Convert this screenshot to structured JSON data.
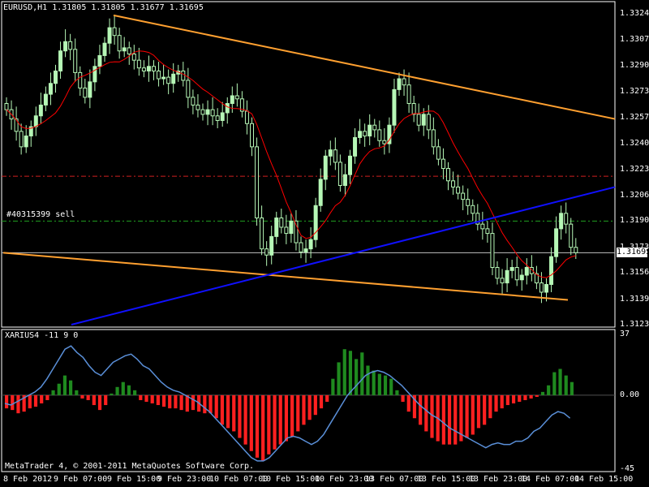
{
  "window": {
    "title": "EURUSD,H1  1.31805 1.31805 1.31677 1.31695",
    "copyright": "MetaTrader 4, © 2001-2011 MetaQuotes Software Corp.",
    "order_label": "#40315399 sell",
    "current_price": "1.31695"
  },
  "indicator": {
    "title": "XARIUS4 -11 9 0",
    "scale": [
      "37",
      "0.00",
      "-45"
    ]
  },
  "colors": {
    "bull_candle": "#b6f7b6",
    "bear_candle": "#000000",
    "ma_line": "#ff0000",
    "trend_orange": "#ffa030",
    "trend_blue": "#1010ff",
    "hist_pos": "#1f8a1f",
    "hist_neg": "#ff2020",
    "signal_line": "#5a8fd8",
    "grid_line": "#ffffff"
  },
  "chart_data": {
    "type": "candlestick",
    "symbol": "EURUSD",
    "timeframe": "H1",
    "y_ticks": [
      "1.33240",
      "1.33070",
      "1.32905",
      "1.32735",
      "1.32570",
      "1.32400",
      "1.32235",
      "1.32065",
      "1.31900",
      "1.31730",
      "1.31565",
      "1.31395",
      "1.31230"
    ],
    "x_ticks": [
      "8 Feb 2012",
      "9 Feb 07:00",
      "9 Feb 15:00",
      "9 Feb 23:00",
      "10 Feb 07:00",
      "10 Feb 15:00",
      "10 Feb 23:00",
      "13 Feb 07:00",
      "13 Feb 15:00",
      "13 Feb 23:00",
      "14 Feb 07:00",
      "14 Feb 15:00"
    ],
    "ylim": [
      1.3123,
      1.3324
    ],
    "closes": [
      1.3262,
      1.3256,
      1.3248,
      1.3238,
      1.3245,
      1.3251,
      1.3258,
      1.3265,
      1.3272,
      1.3279,
      1.3287,
      1.33,
      1.3306,
      1.3301,
      1.3286,
      1.3276,
      1.327,
      1.328,
      1.329,
      1.3297,
      1.3305,
      1.3315,
      1.331,
      1.33,
      1.3302,
      1.3298,
      1.3294,
      1.3289,
      1.3287,
      1.329,
      1.3287,
      1.3282,
      1.3283,
      1.3279,
      1.3285,
      1.3287,
      1.3281,
      1.327,
      1.3265,
      1.3262,
      1.3259,
      1.3262,
      1.3258,
      1.3255,
      1.326,
      1.3266,
      1.3271,
      1.3269,
      1.3261,
      1.3253,
      1.3238,
      1.3192,
      1.3172,
      1.3168,
      1.318,
      1.3192,
      1.3186,
      1.3182,
      1.319,
      1.3176,
      1.317,
      1.3172,
      1.3178,
      1.32,
      1.3217,
      1.3232,
      1.3236,
      1.3228,
      1.3213,
      1.322,
      1.3232,
      1.3244,
      1.3248,
      1.3245,
      1.3252,
      1.3249,
      1.3242,
      1.324,
      1.3252,
      1.3275,
      1.3282,
      1.3278,
      1.3266,
      1.3259,
      1.3252,
      1.3259,
      1.3249,
      1.3238,
      1.323,
      1.3224,
      1.3216,
      1.3212,
      1.3208,
      1.3204,
      1.32,
      1.3195,
      1.3188,
      1.3185,
      1.3182,
      1.316,
      1.3153,
      1.315,
      1.3158,
      1.316,
      1.3152,
      1.3155,
      1.316,
      1.3156,
      1.315,
      1.3144,
      1.3149,
      1.3167,
      1.3185,
      1.3195,
      1.3188,
      1.3173,
      1.31695
    ],
    "indicator_hist": [
      -8,
      -9,
      -11,
      -10,
      -8,
      -7,
      -5,
      -3,
      3,
      7,
      12,
      9,
      3,
      -2,
      -3,
      -6,
      -9,
      -6,
      1,
      5,
      8,
      6,
      3,
      -3,
      -4,
      -5,
      -6,
      -7,
      -8,
      -8,
      -9,
      -10,
      -9,
      -10,
      -11,
      -11,
      -14,
      -18,
      -20,
      -22,
      -26,
      -30,
      -34,
      -38,
      -40,
      -36,
      -33,
      -30,
      -28,
      -25,
      -22,
      -18,
      -15,
      -12,
      -8,
      -4,
      10,
      20,
      28,
      27,
      22,
      26,
      18,
      15,
      13,
      12,
      10,
      3,
      -4,
      -10,
      -14,
      -18,
      -22,
      -26,
      -28,
      -30,
      -30,
      -30,
      -28,
      -26,
      -24,
      -20,
      -18,
      -14,
      -10,
      -8,
      -6,
      -5,
      -4,
      -3,
      -2,
      -1,
      2,
      6,
      14,
      16,
      12,
      8
    ],
    "indicator_signal": [
      -5,
      -6,
      -4,
      -2,
      0,
      2,
      5,
      10,
      16,
      22,
      28,
      30,
      26,
      23,
      18,
      14,
      12,
      16,
      20,
      22,
      24,
      25,
      22,
      18,
      16,
      12,
      8,
      5,
      3,
      2,
      0,
      -2,
      -4,
      -7,
      -10,
      -14,
      -18,
      -22,
      -26,
      -30,
      -34,
      -38,
      -40,
      -40,
      -38,
      -34,
      -30,
      -26,
      -25,
      -26,
      -28,
      -30,
      -28,
      -24,
      -18,
      -12,
      -6,
      0,
      4,
      8,
      12,
      14,
      15,
      14,
      12,
      9,
      6,
      2,
      -2,
      -6,
      -9,
      -12,
      -14,
      -17,
      -20,
      -22,
      -24,
      -26,
      -28,
      -30,
      -32,
      -30,
      -29,
      -30,
      -30,
      -28,
      -28,
      -26,
      -22,
      -20,
      -16,
      -12,
      -10,
      -11,
      -14
    ]
  }
}
